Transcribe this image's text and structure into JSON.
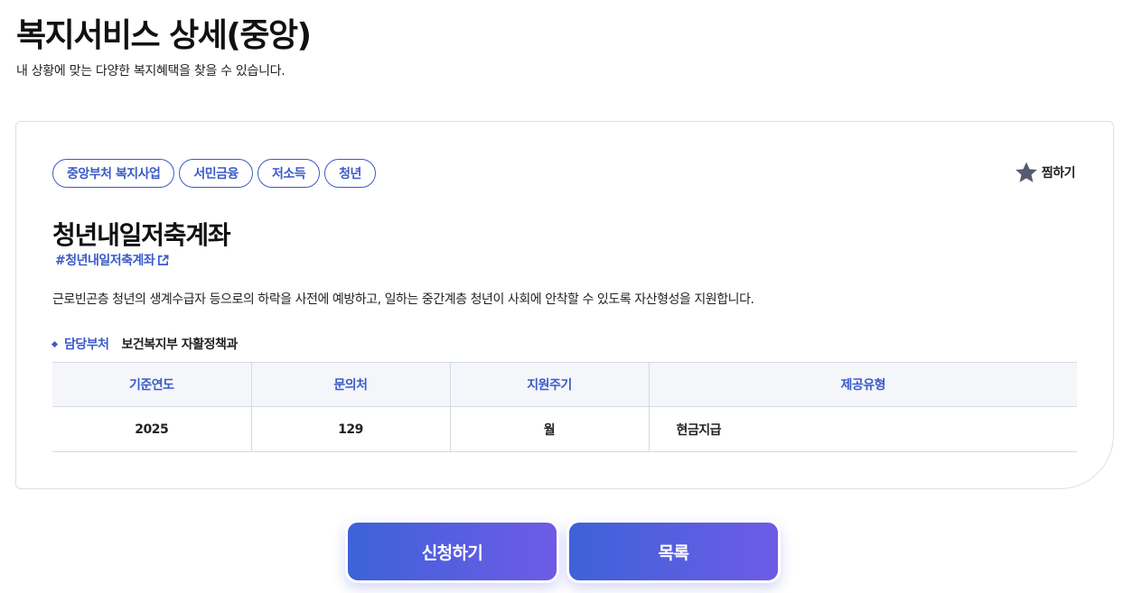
{
  "header": {
    "title": "복지서비스 상세(중앙)",
    "subtitle": "내 상황에 맞는 다양한 복지혜택을 찾을 수 있습니다."
  },
  "service": {
    "tags": [
      "중앙부처 복지사업",
      "서민금융",
      "저소득",
      "청년"
    ],
    "favorite_label": "찜하기",
    "title": "청년내일저축계좌",
    "hashtag": "#청년내일저축계좌",
    "description": "근로빈곤층 청년의 생계수급자 등으로의 하락을 사전에 예방하고, 일하는 중간계층 청년이 사회에 안착할 수 있도록 자산형성을 지원합니다.",
    "department_label": "담당부처",
    "department_value": "보건복지부 자활정책과"
  },
  "table": {
    "headers": [
      "기준연도",
      "문의처",
      "지원주기",
      "제공유형"
    ],
    "row": [
      "2025",
      "129",
      "월",
      "현금지급"
    ]
  },
  "actions": {
    "apply_label": "신청하기",
    "list_label": "목록"
  },
  "colors": {
    "accent": "#3a5bc7",
    "button_gradient_start": "#3d62d8",
    "button_gradient_end": "#6e5be6"
  },
  "icons": {
    "favorite": "star-icon",
    "external_link": "external-link-icon"
  }
}
